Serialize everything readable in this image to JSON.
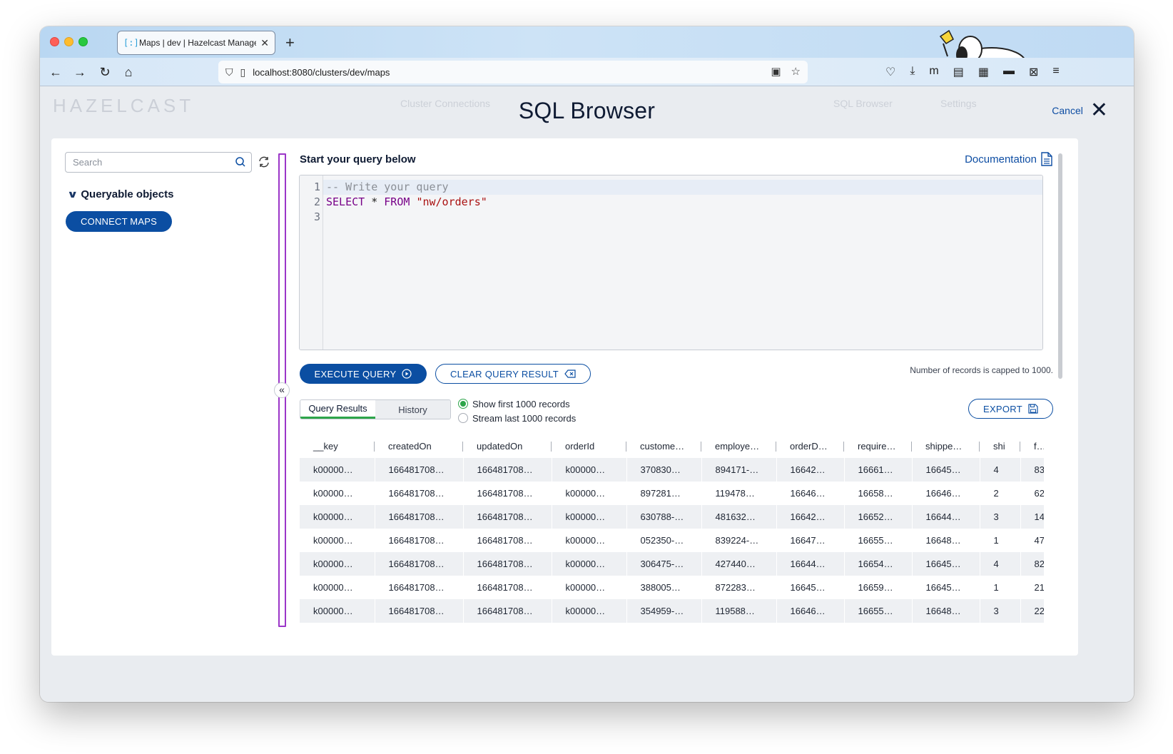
{
  "browser": {
    "tab_title": "Maps | dev | Hazelcast Managem",
    "url": "localhost:8080/clusters/dev/maps"
  },
  "dialog": {
    "title": "SQL Browser",
    "cancel_label": "Cancel"
  },
  "left_panel": {
    "search_placeholder": "Search",
    "section_label": "Queryable objects",
    "connect_button": "CONNECT MAPS"
  },
  "editor": {
    "heading": "Start your query below",
    "documentation_label": "Documentation",
    "lines": [
      {
        "num": "1",
        "comment": "-- Write your query"
      },
      {
        "num": "2",
        "kw1": "SELECT",
        "op": "*",
        "kw2": "FROM",
        "str": "\"nw/orders\""
      },
      {
        "num": "3"
      }
    ]
  },
  "actions": {
    "execute_label": "EXECUTE QUERY",
    "clear_label": "CLEAR QUERY RESULT",
    "capped_note": "Number of records is capped to 1000.",
    "export_label": "EXPORT"
  },
  "results_tabs": {
    "query_results": "Query Results",
    "history": "History"
  },
  "record_options": {
    "show_first": "Show first 1000 records",
    "stream_last": "Stream last 1000 records",
    "selected": "show_first"
  },
  "table": {
    "columns": [
      "__key",
      "createdOn",
      "updatedOn",
      "orderId",
      "custome…",
      "employe…",
      "orderD…",
      "require…",
      "shippe…",
      "shi",
      "f…"
    ],
    "rows": [
      [
        "k00000…",
        "166481708…",
        "166481708…",
        "k00000…",
        "370830…",
        "894171-…",
        "16642…",
        "16661…",
        "16645…",
        "4",
        "83"
      ],
      [
        "k00000…",
        "166481708…",
        "166481708…",
        "k00000…",
        "897281…",
        "119478…",
        "16646…",
        "16658…",
        "16646…",
        "2",
        "62"
      ],
      [
        "k00000…",
        "166481708…",
        "166481708…",
        "k00000…",
        "630788-…",
        "481632…",
        "16642…",
        "16652…",
        "16644…",
        "3",
        "14"
      ],
      [
        "k00000…",
        "166481708…",
        "166481708…",
        "k00000…",
        "052350-…",
        "839224-…",
        "16647…",
        "16655…",
        "16648…",
        "1",
        "47"
      ],
      [
        "k00000…",
        "166481708…",
        "166481708…",
        "k00000…",
        "306475-…",
        "427440…",
        "16644…",
        "16654…",
        "16645…",
        "4",
        "82"
      ],
      [
        "k00000…",
        "166481708…",
        "166481708…",
        "k00000…",
        "388005…",
        "872283…",
        "16645…",
        "16659…",
        "16645…",
        "1",
        "21"
      ],
      [
        "k00000…",
        "166481708…",
        "166481708…",
        "k00000…",
        "354959-…",
        "119588…",
        "16646…",
        "16655…",
        "16648…",
        "3",
        "22"
      ]
    ]
  },
  "background_ghost": {
    "brand": "HAZELCAST",
    "nav_cluster": "Cluster Connections",
    "nav_sql": "SQL Browser",
    "nav_settings": "Settings"
  }
}
